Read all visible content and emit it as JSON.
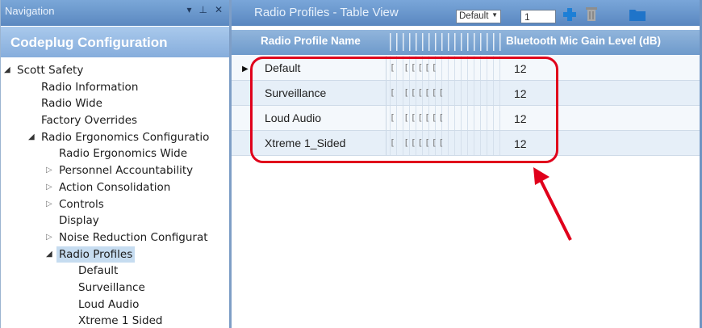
{
  "nav": {
    "header": "Navigation",
    "controls": [
      "▾",
      "⊥",
      "✕"
    ],
    "title": "Codeplug Configuration",
    "tree": [
      {
        "label": "Scott Safety",
        "level": 0,
        "twisty": "open"
      },
      {
        "label": "Radio Information",
        "level": 1,
        "twisty": "none"
      },
      {
        "label": "Radio Wide",
        "level": 1,
        "twisty": "none"
      },
      {
        "label": "Factory Overrides",
        "level": 1,
        "twisty": "none"
      },
      {
        "label": "Radio Ergonomics Configuratio",
        "level": 1,
        "twisty": "open"
      },
      {
        "label": "Radio Ergonomics Wide",
        "level": 2,
        "twisty": "none"
      },
      {
        "label": "Personnel Accountability",
        "level": 2,
        "twisty": "closed"
      },
      {
        "label": "Action Consolidation",
        "level": 2,
        "twisty": "closed"
      },
      {
        "label": "Controls",
        "level": 2,
        "twisty": "closed"
      },
      {
        "label": "Display",
        "level": 2,
        "twisty": "none"
      },
      {
        "label": "Noise Reduction Configurat",
        "level": 2,
        "twisty": "closed"
      },
      {
        "label": "Radio Profiles",
        "level": 2,
        "twisty": "open",
        "selected": true
      },
      {
        "label": "Default",
        "level": 3,
        "twisty": "none"
      },
      {
        "label": "Surveillance",
        "level": 3,
        "twisty": "none"
      },
      {
        "label": "Loud Audio",
        "level": 3,
        "twisty": "none"
      },
      {
        "label": "Xtreme 1 Sided",
        "level": 3,
        "twisty": "none"
      }
    ]
  },
  "main": {
    "title": "Radio Profiles - Table View",
    "view_select": "Default",
    "page_value": "1",
    "columns": {
      "name": "Radio Profile Name",
      "gain": "Bluetooth Mic Gain Level (dB)"
    },
    "rows": [
      {
        "name": "Default",
        "glyphs": "[ [[[[[",
        "gain": "12",
        "current": true
      },
      {
        "name": "Surveillance",
        "glyphs": "[ [[[[[[",
        "gain": "12",
        "current": false
      },
      {
        "name": "Loud Audio",
        "glyphs": "[ [[[[[[",
        "gain": "12",
        "current": false
      },
      {
        "name": "Xtreme 1_Sided",
        "glyphs": "[ [[[[[[",
        "gain": "12",
        "current": false
      }
    ]
  },
  "colors": {
    "highlight": "#e0001b",
    "header_blue": "#5a87c0",
    "selected": "#c6dcf0"
  }
}
